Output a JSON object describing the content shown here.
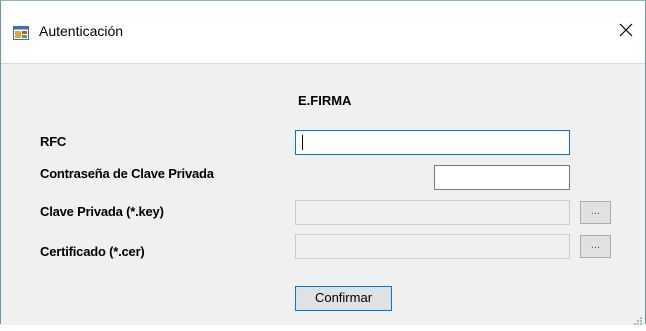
{
  "window": {
    "title": "Autenticación",
    "close_glyph": "✕",
    "icon": "app-window-icon"
  },
  "form": {
    "heading": "E.FIRMA",
    "rfc_label": "RFC",
    "rfc_value": "",
    "password_label": "Contraseña de Clave Privada",
    "password_value": "",
    "key_label": "Clave Privada (*.key)",
    "key_value": "",
    "key_browse_label": "...",
    "cer_label": "Certificado (*.cer)",
    "cer_value": "",
    "cer_browse_label": "...",
    "confirm_label": "Confirmar"
  },
  "colors": {
    "client_background": "#f0f0f0",
    "focus_border": "#0078d7"
  }
}
